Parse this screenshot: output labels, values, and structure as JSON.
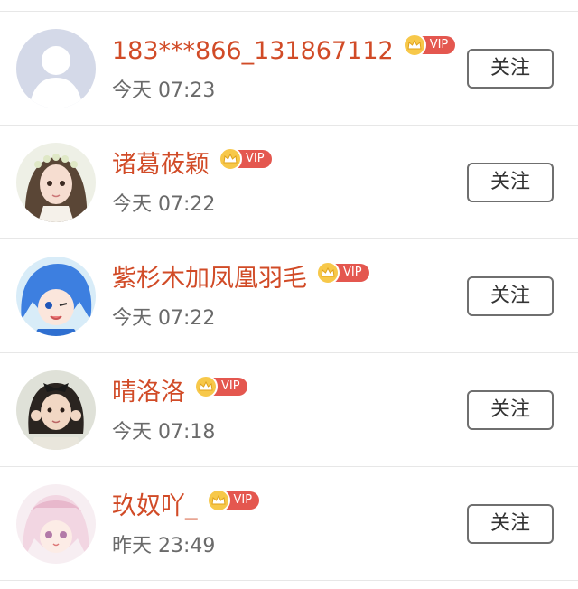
{
  "follow_label": "关注",
  "vip_label": "VIP",
  "colors": {
    "name": "#d14b27",
    "vip_badge": "#e4574f",
    "crown": "#f7c84a",
    "time": "#6a6a6a",
    "divider": "#e7e7e7"
  },
  "users": [
    {
      "name": "183***866_131867112",
      "time": "今天 07:23",
      "avatar": "default-avatar-icon"
    },
    {
      "name": "诸葛莜颖",
      "time": "今天 07:22",
      "avatar": "anime-girl-flower-crown"
    },
    {
      "name": "紫杉木加凤凰羽毛",
      "time": "今天 07:22",
      "avatar": "anime-blue-hair-wink"
    },
    {
      "name": "晴洛洛",
      "time": "今天 07:18",
      "avatar": "girl-photo-bow"
    },
    {
      "name": "玖奴吖_",
      "time": "昨天 23:49",
      "avatar": "anime-pink-hair"
    }
  ]
}
